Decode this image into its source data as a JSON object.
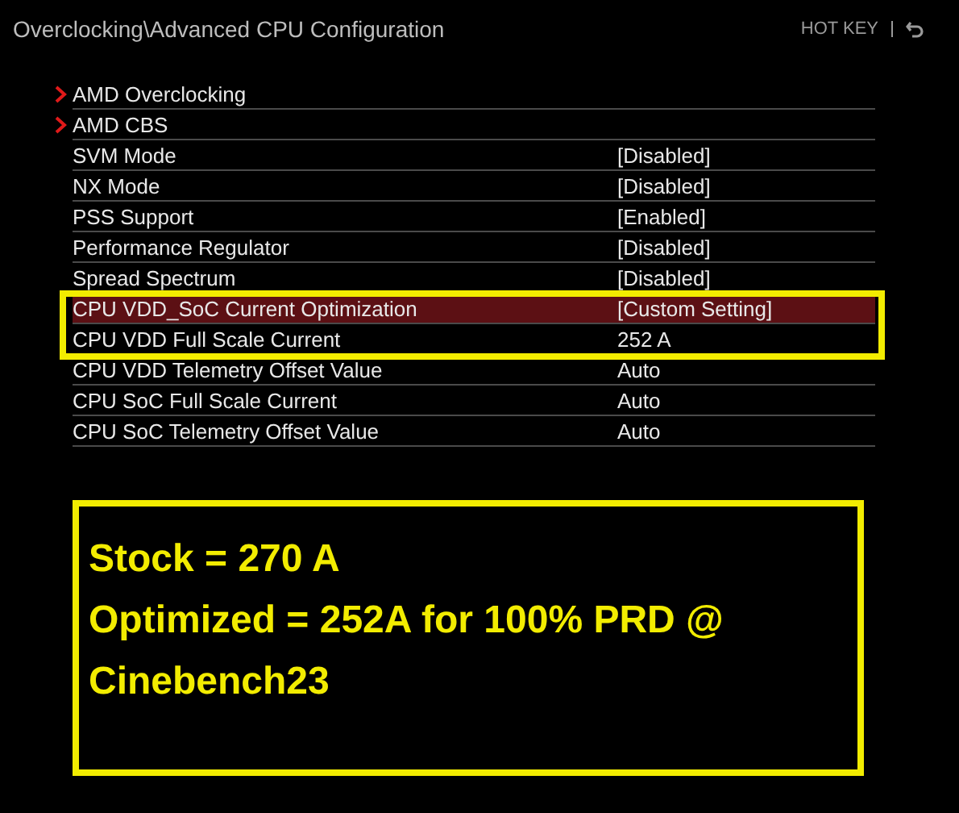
{
  "header": {
    "title": "Overclocking\\Advanced CPU Configuration",
    "hotkey": "HOT KEY"
  },
  "items": [
    {
      "kind": "submenu",
      "label": "AMD Overclocking",
      "selected": false
    },
    {
      "kind": "submenu",
      "label": "AMD CBS",
      "selected": false
    },
    {
      "kind": "setting",
      "label": "SVM Mode",
      "value": "[Disabled]",
      "selected": false
    },
    {
      "kind": "setting",
      "label": "NX Mode",
      "value": "[Disabled]",
      "selected": false
    },
    {
      "kind": "setting",
      "label": "PSS Support",
      "value": "[Enabled]",
      "selected": false
    },
    {
      "kind": "setting",
      "label": "Performance Regulator",
      "value": "[Disabled]",
      "selected": false
    },
    {
      "kind": "setting",
      "label": "Spread Spectrum",
      "value": "[Disabled]",
      "selected": false
    },
    {
      "kind": "setting",
      "label": "CPU VDD_SoC Current Optimization",
      "value": "[Custom Setting]",
      "selected": true
    },
    {
      "kind": "setting",
      "label": "CPU VDD Full Scale Current",
      "value": "252 A",
      "selected": false
    },
    {
      "kind": "setting",
      "label": "CPU VDD Telemetry Offset Value",
      "value": "Auto",
      "selected": false
    },
    {
      "kind": "setting",
      "label": "CPU SoC Full Scale Current",
      "value": "Auto",
      "selected": false
    },
    {
      "kind": "setting",
      "label": "CPU SoC Telemetry Offset Value",
      "value": "Auto",
      "selected": false
    }
  ],
  "annotation": {
    "lines": [
      "Stock = 270 A",
      "Optimized = 252A for 100% PRD @ Cinebench23"
    ]
  }
}
